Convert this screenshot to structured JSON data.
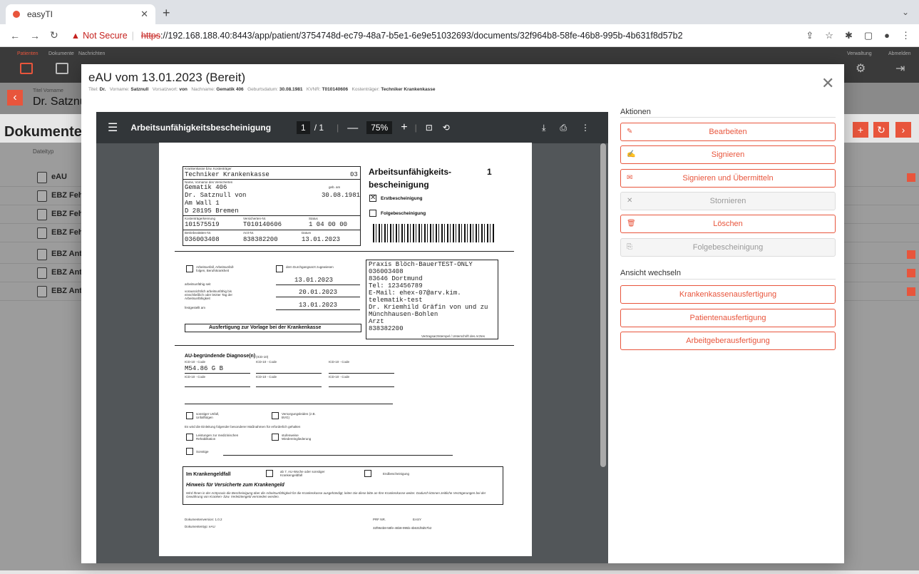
{
  "browser": {
    "tab_title": "easyTI",
    "url_prefix": "https",
    "url_rest": "://192.168.188.40:8443/app/patient/3754748d-ec79-48a7-b5e1-6e9e51032693/documents/32f964b8-58fe-46b8-995b-4b631f8d57b2",
    "not_secure": "Not Secure"
  },
  "appnav": {
    "items": [
      "Patienten",
      "Dokumente",
      "Nachrichten"
    ],
    "right_items": [
      "Verwaltung",
      "Abmelden"
    ]
  },
  "background": {
    "patient_prefix": "Dr.",
    "patient_name": "Satznu",
    "title_label": "Titel   Vorname",
    "section_title": "Dokumente",
    "col_header": "Dateityp",
    "rows": [
      "eAU",
      "EBZ Fehl",
      "EBZ Fehl",
      "EBZ Fehl",
      "EBZ Antr",
      "EBZ Antr",
      "EBZ Antr"
    ]
  },
  "modal": {
    "title": "eAU vom 13.01.2023 (Bereit)",
    "meta": [
      {
        "k": "Titel:",
        "v": "Dr."
      },
      {
        "k": "Vorname:",
        "v": "Satznull"
      },
      {
        "k": "Vorsatzwort:",
        "v": "von"
      },
      {
        "k": "Nachname:",
        "v": "Gematik 406"
      },
      {
        "k": "Geburtsdatum:",
        "v": "30.08.1981"
      },
      {
        "k": "KVNR:",
        "v": "T010140606"
      },
      {
        "k": "Kostenträger:",
        "v": "Techniker Krankenkasse"
      }
    ]
  },
  "pdf": {
    "name": "Arbeitsunfähigkeitsbescheinigung",
    "page": "1",
    "pages": "/ 1",
    "zoom": "75%",
    "kasse": "Techniker Krankenkasse",
    "kasse_nr": "03",
    "name_line1": "Gematik 406",
    "geb_label": "geb. am",
    "name_line2": "Dr. Satznull von",
    "geb": "30.08.1981",
    "street": "Am Wall 1",
    "city": "D 28195 Bremen",
    "kostentraeger": "101575519",
    "versicherten": "T010140606",
    "status": "1 04 00 00",
    "bsnr": "036003408",
    "lanr": "838382200",
    "datum": "13.01.2023",
    "doc_title": "Arbeitsunfähigkeits-",
    "doc_title2": "bescheinigung",
    "doc_num": "1",
    "erst": "Erstbescheinigung",
    "folge": "Folgebescheinigung",
    "arbeitsunfall": "Arbeitsunfall, Arbeitsunfall-folgen, Berufskrankheit",
    "durchgang": "dem Durchgangsarzt zugewiesen",
    "seit_label": "arbeitsunfähig seit",
    "seit": "13.01.2023",
    "bis_label": "voraussichtlich arbeitsunfähig bis einschließlich oder letzter Tag der Arbeitsunfähigkeit",
    "bis": "20.01.2023",
    "festgestellt_label": "festgestellt am",
    "festgestellt": "13.01.2023",
    "ausfertigung": "Ausfertigung zur Vorlage bei der Krankenkasse",
    "praxis": [
      "Praxis Blöch-BauerTEST-ONLY",
      "036003408",
      "83646 Dortmund",
      "Tel: 123456789",
      "E-Mail: ehex-07@arv.kim.",
      "telematik-test",
      "Dr. Kriemhild Gräfin von und zu",
      "Münchhausen-Bohlen",
      "Arzt",
      "838382200"
    ],
    "stempel": "Vertragsarztstempel / Unterschrift des Arztes",
    "diag_title": "AU-begründende Diagnose(n)",
    "diag_small": "(ICD-10)",
    "icd_label": "ICD-10 - Code",
    "diag_code": "M54.86   G   B",
    "sonstiger_unfall": "sonstiger Unfall, Unfallfolgen",
    "versorgung": "Versorgungsleiden (z.B. BVG)",
    "massnahmen": "Es wird die Einleitung folgender besonderer Maßnahmen für erforderlich gehalten",
    "leistungen": "Leistungen zur medizinischen Rehabilitation",
    "stufenweise": "stufenweise Wiedereingliederung",
    "sonstige": "Sonstige",
    "krankengeld": "Im Krankengeldfall",
    "ab7": "ab 7. AU-Woche oder sonstiger Krankengeldfall",
    "endbesch": "Endbescheinigung",
    "hinweis": "Hinweis für Versicherte zum Krankengeld",
    "hinweis_text": "Wird Ihnen in der Arztpraxis die Bescheinigung über die Arbeitsunfähigkeit für die Krankenkasse ausgehändigt, leiten Sie diese bitte an Ihre Krankenkasse weiter. Dadurch können zeitliche Verzögerungen bei der Gewährung von Kranken- bzw. Verletztengeld vermieden werden.",
    "dokversion": "Dokumentenversion: 1.0.2",
    "doktyp": "Dokumententyp: eAU",
    "prf": "PRF NR.",
    "easy": "EASY",
    "id": "32f964b8-58fe-46b8-995b-4b631f8d57b2"
  },
  "actions": {
    "title": "Aktionen",
    "buttons": [
      {
        "label": "Bearbeiten",
        "icon": "pencil-icon",
        "glyph": "✎",
        "enabled": true
      },
      {
        "label": "Signieren",
        "icon": "sign-icon",
        "glyph": "✍",
        "enabled": true
      },
      {
        "label": "Signieren und Übermitteln",
        "icon": "mail-icon",
        "glyph": "✉",
        "enabled": true
      },
      {
        "label": "Stornieren",
        "icon": "x-icon",
        "glyph": "✕",
        "enabled": false
      },
      {
        "label": "Löschen",
        "icon": "trash-icon",
        "glyph": "🗑",
        "enabled": true
      },
      {
        "label": "Folgebescheinigung",
        "icon": "copy-icon",
        "glyph": "⎘",
        "enabled": false
      }
    ]
  },
  "views": {
    "title": "Ansicht wechseln",
    "buttons": [
      "Krankenkassenausfertigung",
      "Patientenausfertigung",
      "Arbeitgeberausfertigung"
    ]
  },
  "colors": {
    "accent": "#e8553c"
  }
}
